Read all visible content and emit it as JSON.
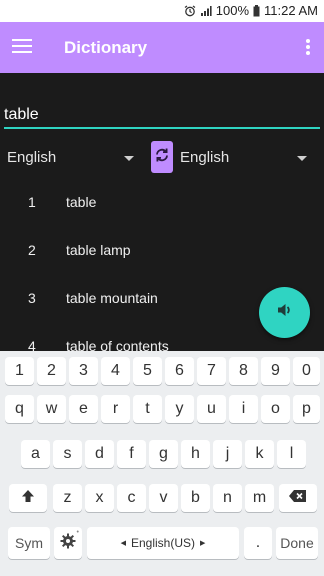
{
  "status_bar": {
    "battery_percent": "100%",
    "time": "11:22 AM",
    "icons": [
      "alarm-icon",
      "signal-icon",
      "battery-icon"
    ]
  },
  "app_bar": {
    "title": "Dictionary",
    "menu_icon": "hamburger-menu-icon",
    "overflow_icon": "more-vert-icon",
    "color": "#bf8cff"
  },
  "search": {
    "value": "table",
    "accent": "#2fd4c2"
  },
  "languages": {
    "from": "English",
    "to": "English",
    "swap_icon": "swap-refresh-icon"
  },
  "results": [
    {
      "num": "1",
      "word": "table"
    },
    {
      "num": "2",
      "word": "table lamp"
    },
    {
      "num": "3",
      "word": "table mountain"
    },
    {
      "num": "4",
      "word": "table of contents"
    }
  ],
  "fab": {
    "icon": "speaker-icon",
    "color": "#2fd4c2"
  },
  "keyboard": {
    "row1": [
      "1",
      "2",
      "3",
      "4",
      "5",
      "6",
      "7",
      "8",
      "9",
      "0"
    ],
    "row2": [
      "q",
      "w",
      "e",
      "r",
      "t",
      "y",
      "u",
      "i",
      "o",
      "p"
    ],
    "row3": [
      "a",
      "s",
      "d",
      "f",
      "g",
      "h",
      "j",
      "k",
      "l"
    ],
    "row4": [
      "z",
      "x",
      "c",
      "v",
      "b",
      "n",
      "m"
    ],
    "shift_icon": "shift-arrow-icon",
    "backspace_icon": "backspace-icon",
    "sym": "Sym",
    "settings_icon": "gear-icon",
    "space_label": "English(US)",
    "period": ".",
    "done": "Done"
  }
}
